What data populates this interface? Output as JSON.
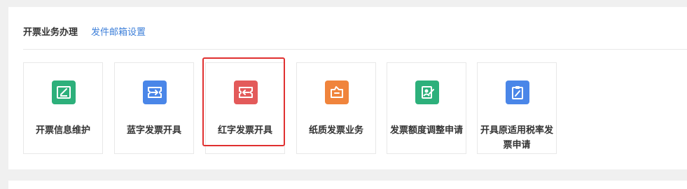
{
  "tabs": {
    "active_label": "开票业务办理",
    "link_label": "发件邮箱设置"
  },
  "cards": [
    {
      "label": "开票信息维护",
      "icon": "edit-form-icon",
      "color": "#2db07b"
    },
    {
      "label": "蓝字发票开具",
      "icon": "ticket-right-arrow-icon",
      "color": "#4a86e8"
    },
    {
      "label": "红字发票开具",
      "icon": "ticket-left-arrow-icon",
      "color": "#e35a5a"
    },
    {
      "label": "纸质发票业务",
      "icon": "paper-ticket-icon",
      "color": "#f0843c"
    },
    {
      "label": "发票额度调整申请",
      "icon": "adjust-document-icon",
      "color": "#2db07b"
    },
    {
      "label": "开具原适用税率发票申请",
      "icon": "clipboard-edit-icon",
      "color": "#4a86e8"
    }
  ],
  "colors": {
    "link": "#3d7fd9",
    "highlight": "#e03030"
  }
}
